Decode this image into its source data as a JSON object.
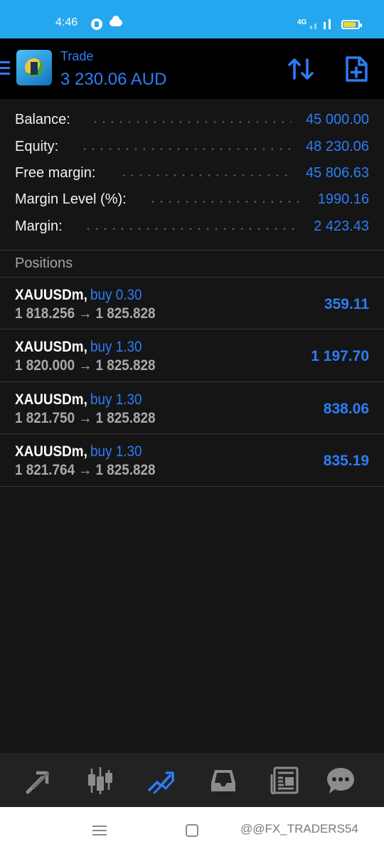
{
  "status_bar": {
    "time": "4:46",
    "network": "4G",
    "icons": [
      "app-notification-icon",
      "cloud-icon",
      "signal-icon",
      "battery-icon"
    ]
  },
  "header": {
    "title": "Trade",
    "account_value": "3 230.06 AUD",
    "icons": [
      "menu-icon",
      "metatrader-logo",
      "sort-icon",
      "new-order-icon"
    ],
    "accent_color": "#2d7df6"
  },
  "summary": {
    "rows": [
      {
        "label": "Balance:",
        "value": "45 000.00"
      },
      {
        "label": "Equity:",
        "value": "48 230.06"
      },
      {
        "label": "Free margin:",
        "value": "45 806.63"
      },
      {
        "label": "Margin Level (%):",
        "value": "1990.16"
      },
      {
        "label": "Margin:",
        "value": "2 423.43"
      }
    ]
  },
  "positions": {
    "title": "Positions",
    "items": [
      {
        "symbol": "XAUUSDm,",
        "side": "buy 0.30",
        "prices": "1 818.256 → 1 825.828",
        "profit": "359.11"
      },
      {
        "symbol": "XAUUSDm,",
        "side": "buy 1.30",
        "prices": "1 820.000 → 1 825.828",
        "profit": "1 197.70"
      },
      {
        "symbol": "XAUUSDm,",
        "side": "buy 1.30",
        "prices": "1 821.750 → 1 825.828",
        "profit": "838.06"
      },
      {
        "symbol": "XAUUSDm,",
        "side": "buy 1.30",
        "prices": "1 821.764 → 1 825.828",
        "profit": "835.19"
      }
    ]
  },
  "bottom_nav": {
    "items": [
      "quotes-icon",
      "chart-icon",
      "trade-icon",
      "history-icon",
      "news-icon",
      "messages-icon"
    ],
    "active": "trade-icon"
  },
  "system_nav": {
    "watermark": "@@FX_TRADERS54",
    "icons": [
      "recent-apps-icon",
      "home-icon"
    ]
  }
}
